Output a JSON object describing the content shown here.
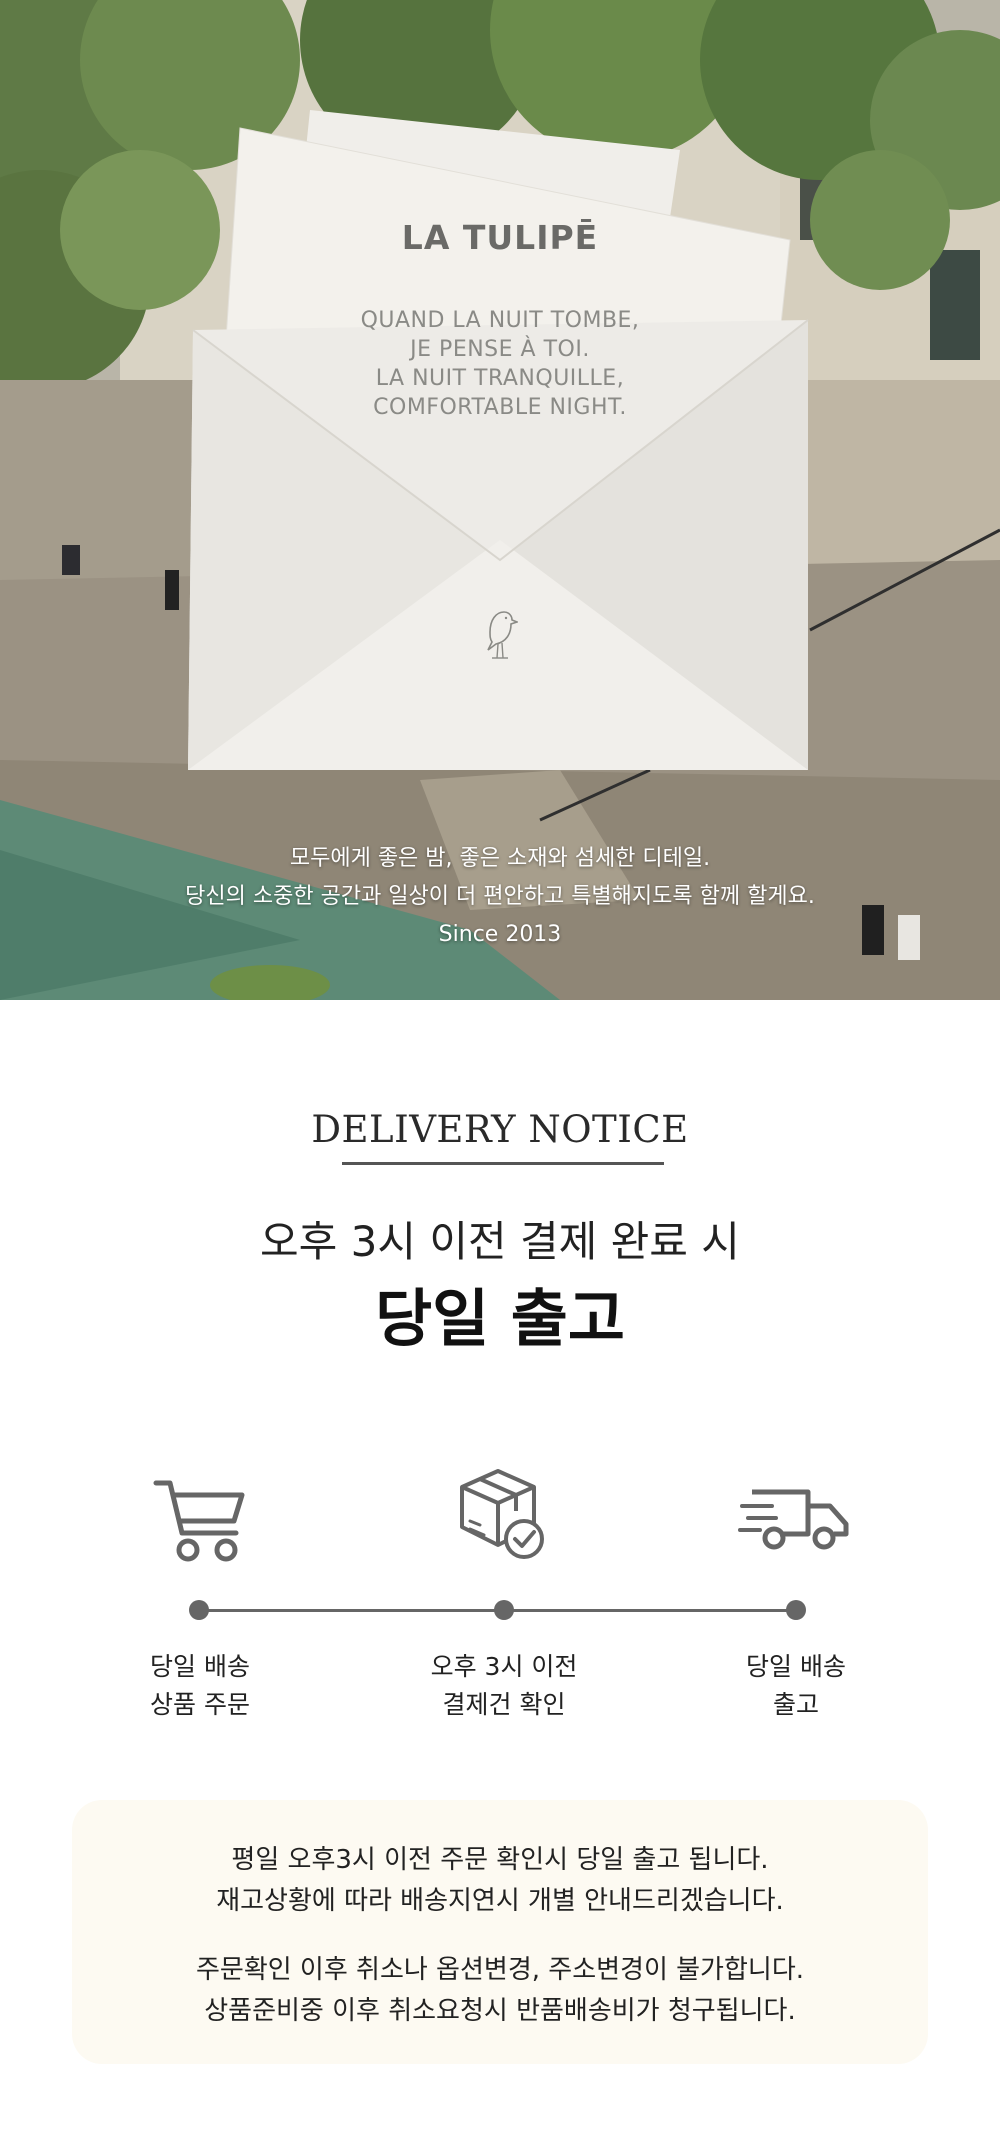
{
  "hero": {
    "brand": "LA TULIPĒ",
    "poem": [
      "QUAND LA NUIT TOMBE,",
      "JE PENSE À TOI.",
      "LA NUIT TRANQUILLE,",
      "COMFORTABLE NIGHT."
    ],
    "caption": [
      "모두에게 좋은 밤, 좋은 소재와 섬세한 디테일.",
      "당신의 소중한 공간과 일상이 더 편안하고 특별해지도록 함께 할게요.",
      "Since 2013"
    ],
    "bird_icon": "bird-icon"
  },
  "notice": {
    "title": "DELIVERY NOTICE",
    "subtitle": "오후 3시 이전 결제 완료 시",
    "main": "당일 출고"
  },
  "steps": [
    {
      "icon": "cart-icon",
      "line1": "당일 배송",
      "line2": "상품 주문"
    },
    {
      "icon": "package-check-icon",
      "line1": "오후 3시 이전",
      "line2": "결제건 확인"
    },
    {
      "icon": "delivery-truck-icon",
      "line1": "당일 배송",
      "line2": "출고"
    }
  ],
  "info": {
    "para1": [
      "평일 오후3시 이전 주문 확인시 당일 출고 됩니다.",
      "재고상황에 따라 배송지연시 개별 안내드리겠습니다."
    ],
    "para2": [
      "주문확인 이후 취소나 옵션변경, 주소변경이 불가합니다.",
      "상품준비중 이후 취소요청시 반품배송비가 청구됩니다."
    ]
  },
  "colors": {
    "icon_gray": "#666666",
    "info_box_bg": "#fdfaf2",
    "text_dark": "#222222"
  }
}
